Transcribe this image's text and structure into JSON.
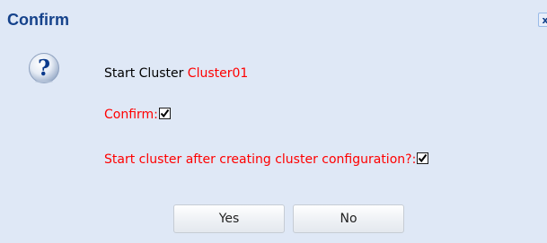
{
  "dialog": {
    "title": "Confirm",
    "close_label": "x",
    "message": {
      "prefix": "Start Cluster ",
      "cluster_name": "Cluster01"
    },
    "options": [
      {
        "label": "Confirm:",
        "checked": true
      },
      {
        "label": "Start cluster after creating cluster configuration?:",
        "checked": true
      }
    ],
    "buttons": {
      "yes_label": "Yes",
      "no_label": "No"
    }
  },
  "icons": {
    "question": "question-icon",
    "close": "close-icon",
    "check": "checkmark-icon"
  },
  "colors": {
    "background": "#dfe8f6",
    "title": "#15428b",
    "accent_red": "#ff0000"
  }
}
